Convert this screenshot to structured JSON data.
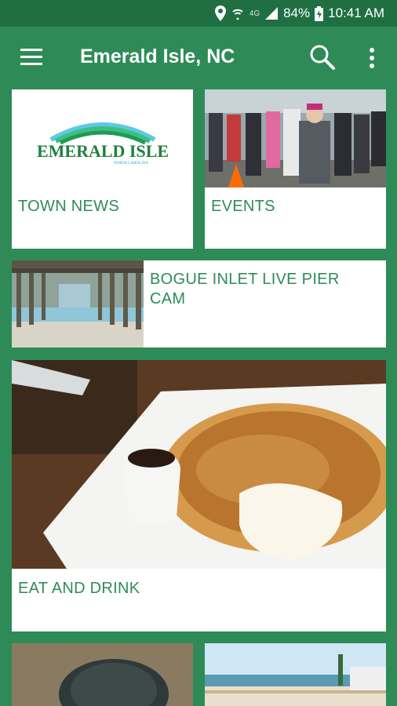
{
  "status": {
    "battery": "84%",
    "time": "10:41 AM",
    "network": "4G"
  },
  "app_bar": {
    "title": "Emerald Isle, NC"
  },
  "tiles": {
    "town_news": {
      "label": "TOWN NEWS",
      "logo_title": "EMERALD ISLE",
      "logo_subtitle": "NORTH CAROLINA"
    },
    "events": {
      "label": "EVENTS"
    },
    "pier_cam": {
      "label": "BOGUE INLET LIVE PIER CAM"
    },
    "eat_drink": {
      "label": "EAT AND DRINK"
    }
  },
  "colors": {
    "primary": "#2e8b57",
    "status_bar": "#1f6f43",
    "card": "#ffffff"
  }
}
